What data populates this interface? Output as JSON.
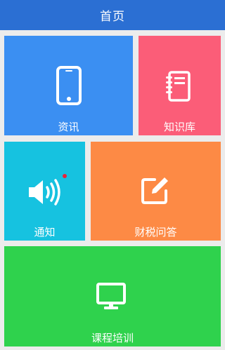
{
  "header": {
    "title": "首页"
  },
  "tiles": [
    {
      "label": "资讯",
      "icon": "smartphone-icon",
      "color": "#3b8ff2"
    },
    {
      "label": "知识库",
      "icon": "notebook-icon",
      "color": "#fb5d78"
    },
    {
      "label": "通知",
      "icon": "speaker-icon",
      "color": "#16c2e0",
      "has_unread_dot": true
    },
    {
      "label": "财税问答",
      "icon": "edit-icon",
      "color": "#fd8a45"
    },
    {
      "label": "课程培训",
      "icon": "monitor-icon",
      "color": "#2fd24d"
    }
  ],
  "colors": {
    "topbar": "#2b6fd3",
    "background": "#ececec",
    "badge": "#e8243c"
  }
}
